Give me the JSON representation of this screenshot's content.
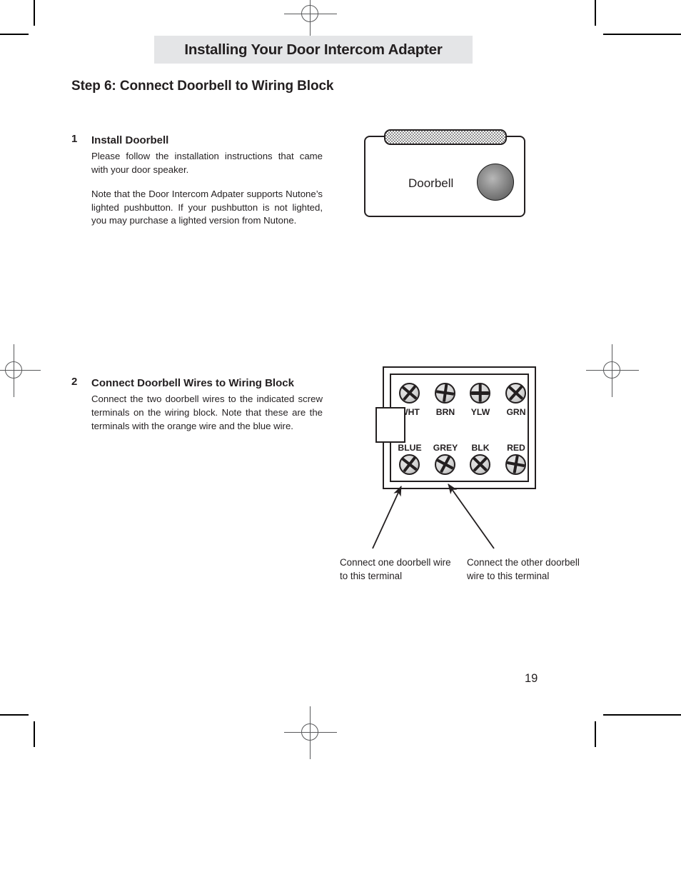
{
  "document": {
    "header_title": "Installing Your Door Intercom Adapter",
    "step_title": "Step 6: Connect Doorbell to Wiring Block",
    "page_number": "19"
  },
  "sections": [
    {
      "number": "1",
      "heading": "Install Doorbell",
      "paragraphs": [
        "Please follow the installation instructions that came with your door speaker.",
        "Note that the Door Intercom Adpater supports Nutone’s lighted pushbutton.  If your pushbutton is not lighted, you may purchase a lighted version from Nutone."
      ]
    },
    {
      "number": "2",
      "heading": "Connect Doorbell Wires to Wiring Block",
      "paragraphs": [
        "Connect the two doorbell wires to the indicated screw terminals on the wiring block.  Note that these are the terminals with the orange wire and the blue wire."
      ]
    }
  ],
  "doorbell_figure": {
    "label": "Doorbell",
    "grille_name": "speaker-grille",
    "button_name": "doorbell-pushbutton"
  },
  "wiring_block": {
    "top_row": [
      {
        "label": "WHT",
        "slot": "x"
      },
      {
        "label": "BRN",
        "slot": "plus"
      },
      {
        "label": "YLW",
        "slot": "plus"
      },
      {
        "label": "GRN",
        "slot": "x"
      }
    ],
    "bottom_row": [
      {
        "label": "BLUE",
        "slot": "x"
      },
      {
        "label": "GREY",
        "slot": "x"
      },
      {
        "label": "BLK",
        "slot": "x"
      },
      {
        "label": "RED",
        "slot": "plus"
      }
    ]
  },
  "callouts": {
    "left": "Connect one doorbell wire to this terminal",
    "right": "Connect the other doorbell wire to this terminal"
  },
  "colors": {
    "header_band": "#e4e5e7",
    "text": "#231f20",
    "rule": "#231f20",
    "mark": "#58595b"
  }
}
